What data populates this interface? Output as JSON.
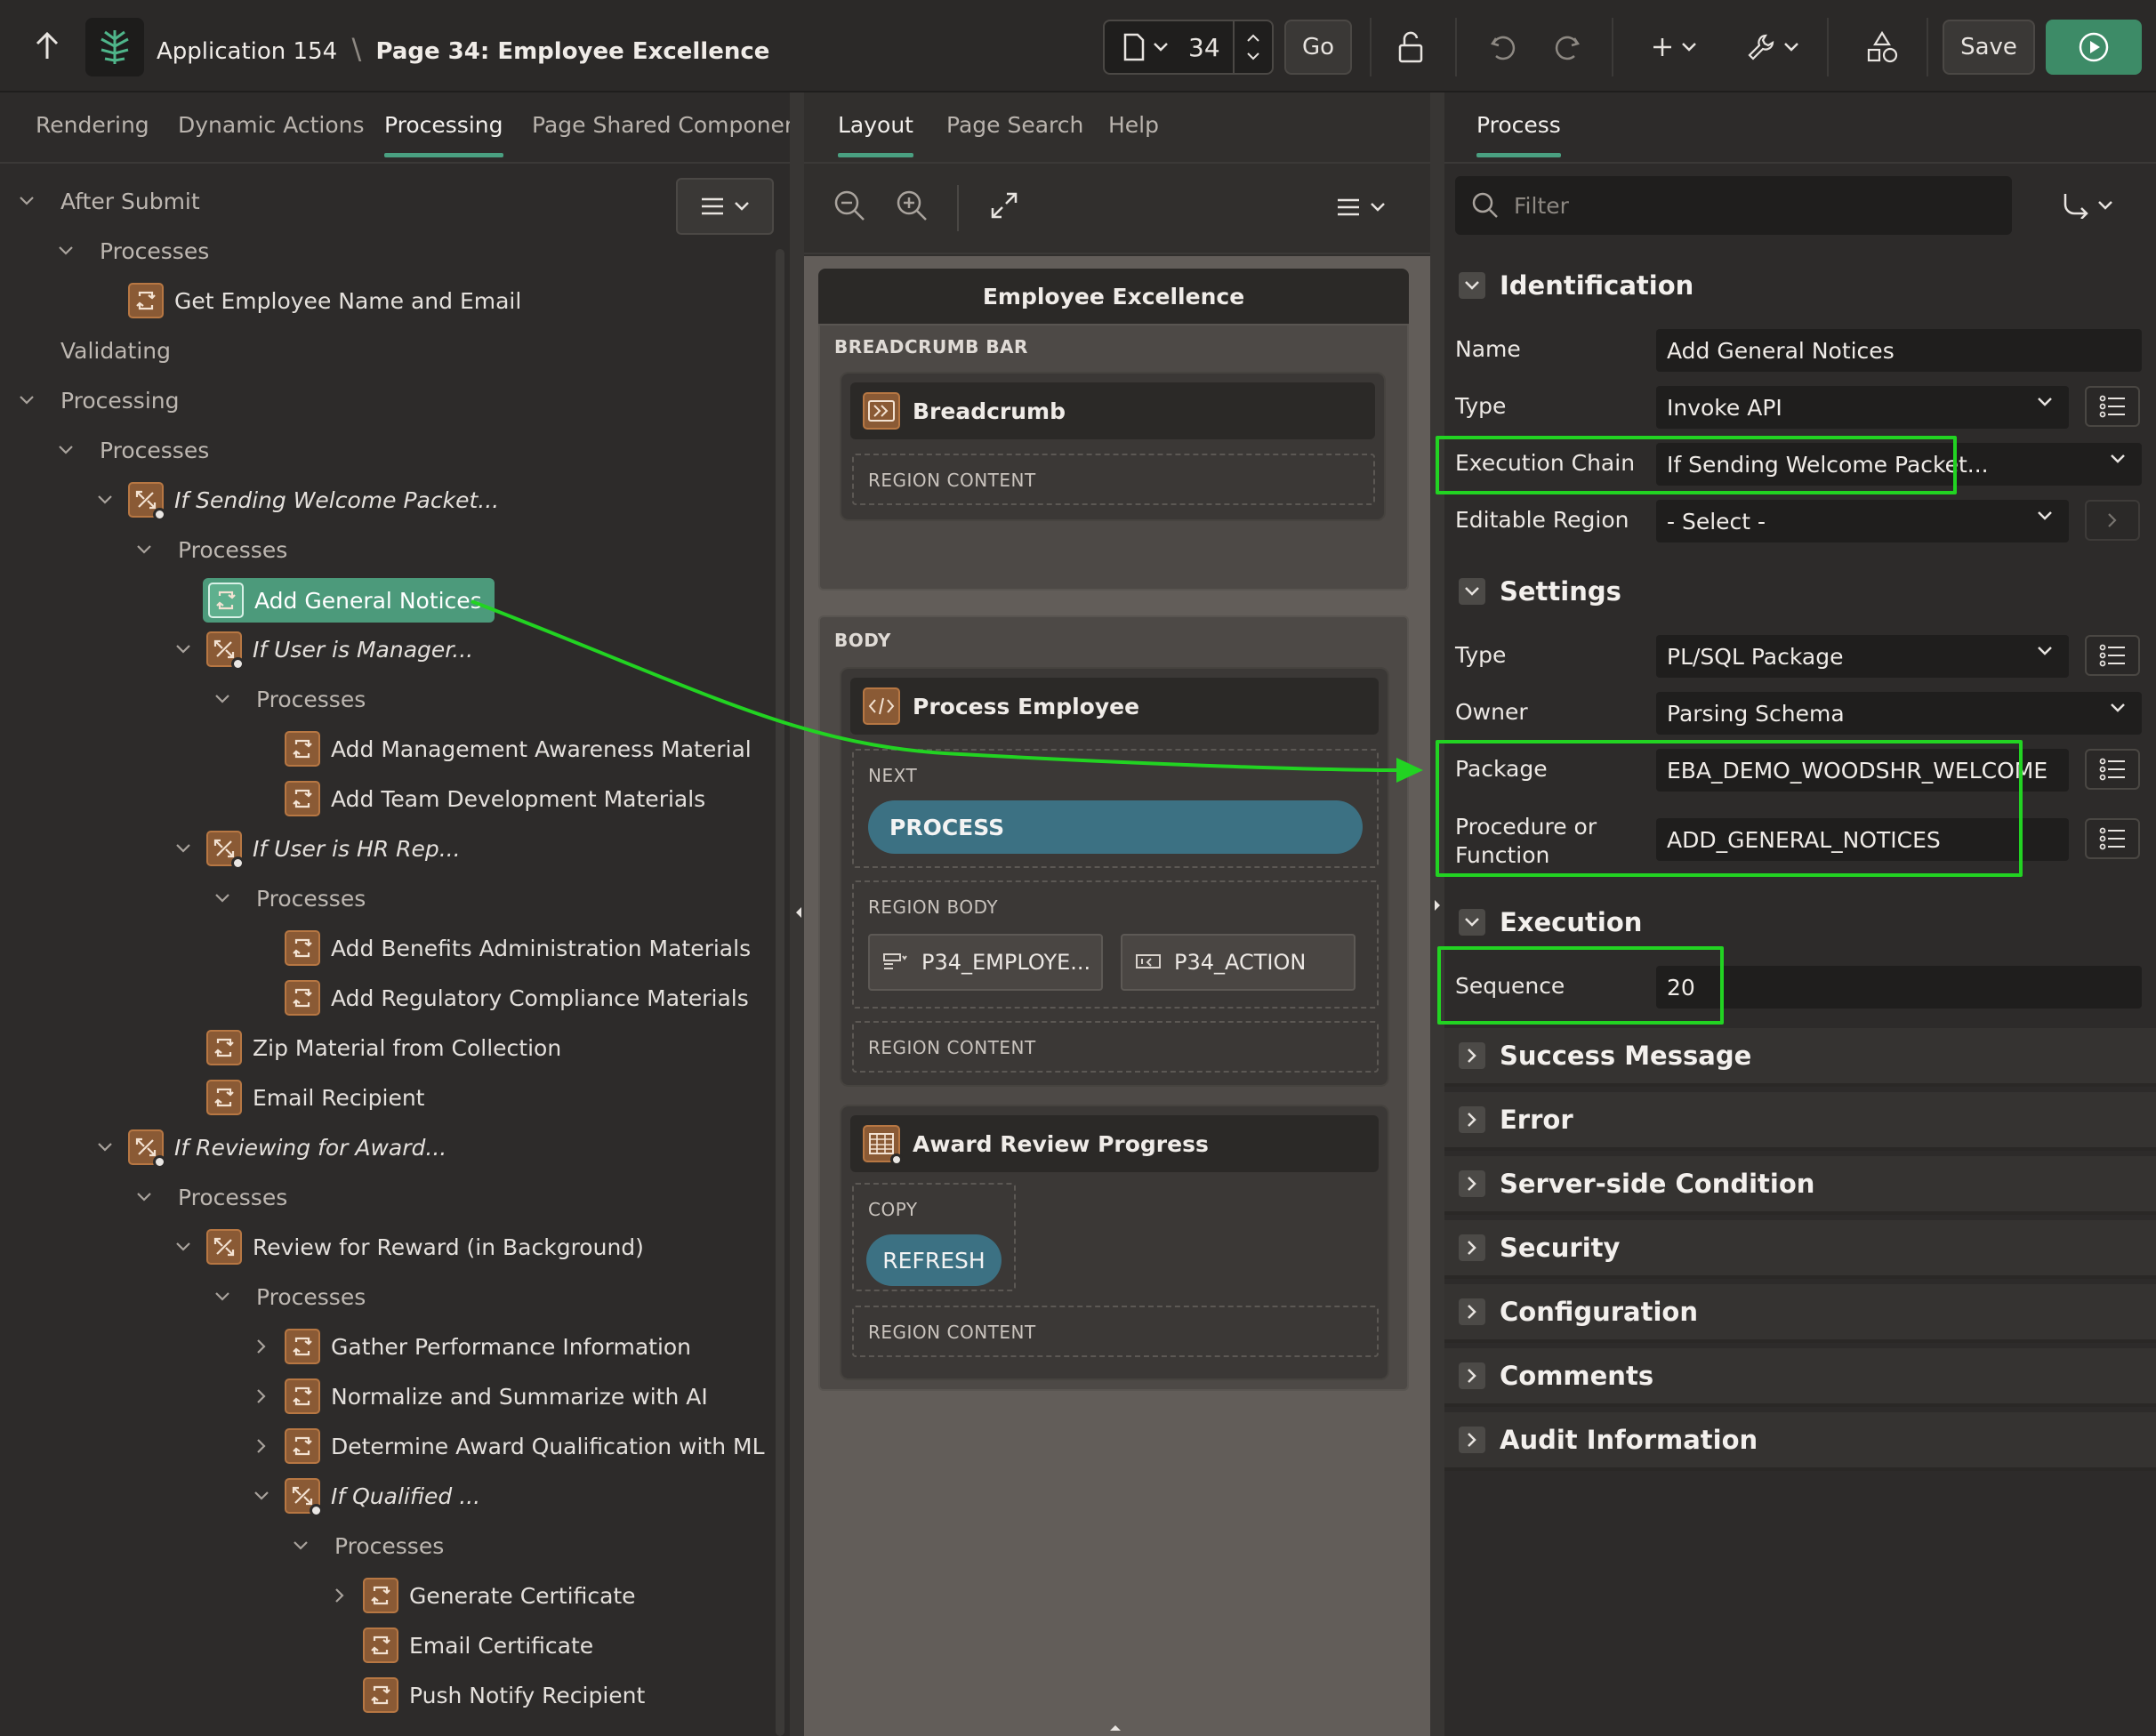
{
  "header": {
    "app_label": "Application 154",
    "page_label": "Page 34: Employee Excellence",
    "page_number": "34",
    "go_label": "Go",
    "save_label": "Save"
  },
  "left_tabs": [
    "Rendering",
    "Dynamic Actions",
    "Processing",
    "Page Shared Components"
  ],
  "mid_tabs": [
    "Layout",
    "Page Search",
    "Help"
  ],
  "right_tabs": [
    "Process"
  ],
  "tree": {
    "after_submit": "After Submit",
    "processes_1": "Processes",
    "get_employee": "Get Employee Name and Email",
    "validating": "Validating",
    "processing": "Processing",
    "processes_2": "Processes",
    "if_sending": "If Sending Welcome Packet...",
    "processes_3": "Processes",
    "add_general": "Add General Notices",
    "if_manager": "If User is Manager...",
    "processes_4": "Processes",
    "add_mgmt": "Add Management Awareness Material",
    "add_team": "Add Team Development Materials",
    "if_hr": "If User is HR Rep...",
    "processes_5": "Processes",
    "add_benefits": "Add Benefits Administration Materials",
    "add_regulatory": "Add Regulatory Compliance Materials",
    "zip": "Zip Material from Collection",
    "email_recipient": "Email Recipient",
    "if_reviewing": "If Reviewing for Award...",
    "processes_6": "Processes",
    "review_reward": "Review for Reward (in Background)",
    "processes_7": "Processes",
    "gather": "Gather Performance Information",
    "normalize": "Normalize and Summarize with AI",
    "determine": "Determine Award Qualification with ML",
    "if_qualified": "If Qualified ...",
    "processes_8": "Processes",
    "gen_cert": "Generate Certificate",
    "email_cert": "Email Certificate",
    "push_notify": "Push Notify Recipient"
  },
  "layout": {
    "page_title": "Employee Excellence",
    "breadcrumb_bar": "BREADCRUMB BAR",
    "breadcrumb": "Breadcrumb",
    "region_content": "REGION CONTENT",
    "body": "BODY",
    "process_employee": "Process Employee",
    "next": "NEXT",
    "process_button": "PROCESS",
    "region_body": "REGION BODY",
    "item1": "P34_EMPLOYE...",
    "item2": "P34_ACTION",
    "award_review": "Award Review Progress",
    "copy": "COPY",
    "refresh_button": "REFRESH"
  },
  "props": {
    "filter_placeholder": "Filter",
    "identification": "Identification",
    "name_label": "Name",
    "name_value": "Add General Notices",
    "type_label": "Type",
    "type_value": "Invoke API",
    "exec_chain_label": "Execution Chain",
    "exec_chain_value": "If Sending Welcome Packet...",
    "editable_region_label": "Editable Region",
    "editable_region_value": "- Select -",
    "settings": "Settings",
    "settings_type_label": "Type",
    "settings_type_value": "PL/SQL Package",
    "owner_label": "Owner",
    "owner_value": "Parsing Schema",
    "package_label": "Package",
    "package_value": "EBA_DEMO_WOODSHR_WELCOME",
    "procedure_label_1": "Procedure or",
    "procedure_label_2": "Function",
    "procedure_value": "ADD_GENERAL_NOTICES",
    "execution": "Execution",
    "sequence_label": "Sequence",
    "sequence_value": "20",
    "collapsed": [
      "Success Message",
      "Error",
      "Server-side Condition",
      "Security",
      "Configuration",
      "Comments",
      "Audit Information"
    ]
  },
  "colors": {
    "accent": "#4aa081",
    "highlight": "#22d322",
    "process_icon": "#8a5a35",
    "button_teal": "#3c7183"
  }
}
